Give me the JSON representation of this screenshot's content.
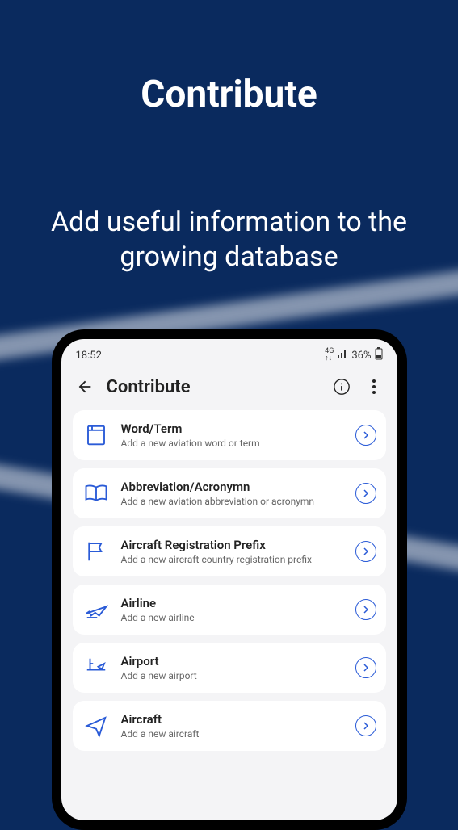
{
  "hero": {
    "title": "Contribute",
    "subtitle": "Add useful information to the growing database"
  },
  "statusbar": {
    "time": "18:52",
    "network": "4G",
    "battery": "36%"
  },
  "appbar": {
    "title": "Contribute"
  },
  "items": [
    {
      "title": "Word/Term",
      "sub": "Add a new aviation word or term",
      "icon": "word"
    },
    {
      "title": "Abbreviation/Acronymn",
      "sub": "Add a new aviation abbreviation or acronymn",
      "icon": "book"
    },
    {
      "title": "Aircraft Registration Prefix",
      "sub": "Add a new aircraft country registration prefix",
      "icon": "flag"
    },
    {
      "title": "Airline",
      "sub": "Add a new airline",
      "icon": "airline"
    },
    {
      "title": "Airport",
      "sub": "Add a new airport",
      "icon": "airport"
    },
    {
      "title": "Aircraft",
      "sub": "Add a new aircraft",
      "icon": "aircraft"
    }
  ]
}
